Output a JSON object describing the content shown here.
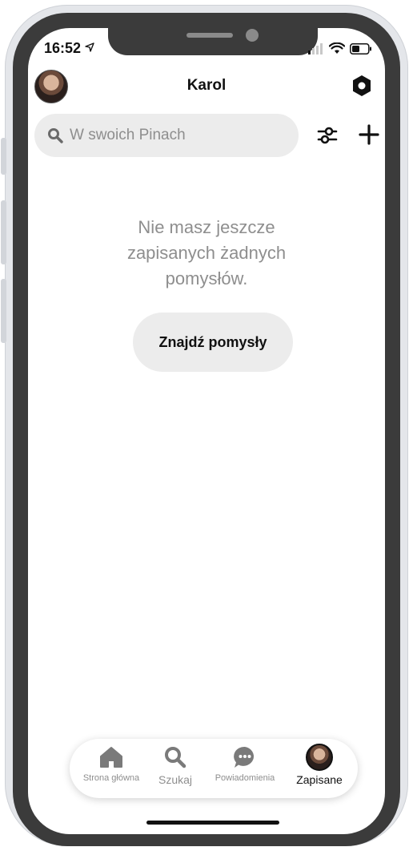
{
  "status_bar": {
    "time": "16:52"
  },
  "header": {
    "title": "Karol"
  },
  "search": {
    "placeholder": "W swoich Pinach"
  },
  "empty_state": {
    "message": "Nie masz jeszcze zapisanych żadnych pomysłów.",
    "button_label": "Znajdź pomysły"
  },
  "tabbar": {
    "tabs": [
      {
        "label": "Strona główna",
        "icon": "home-icon"
      },
      {
        "label": "Szukaj",
        "icon": "search-icon"
      },
      {
        "label": "Powiadomienia",
        "icon": "chat-bubble-icon"
      },
      {
        "label": "Zapisane",
        "icon": "avatar",
        "active": true
      }
    ]
  },
  "colors": {
    "text": "#111111",
    "muted": "#8e8e8e",
    "pill": "#ececec"
  }
}
